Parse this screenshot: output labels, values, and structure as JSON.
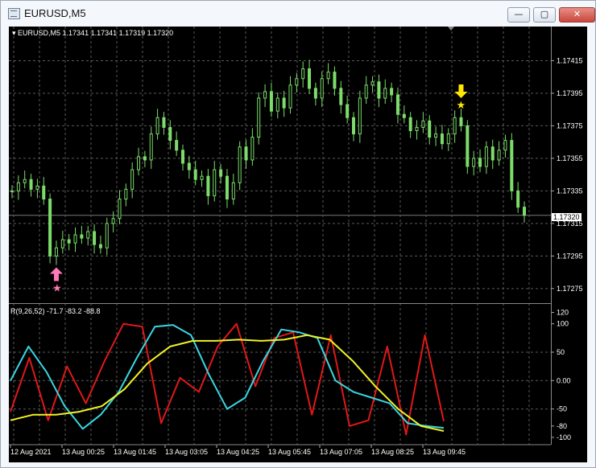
{
  "window": {
    "title": "EURUSD,M5",
    "minimize_label": "—",
    "maximize_label": "▢",
    "close_label": "✕"
  },
  "main_pane": {
    "label": "EURUSD,M5  1.17341 1.17341 1.17319 1.17320",
    "current_price": "1.17320",
    "y_ticks": [
      "1.17415",
      "1.17395",
      "1.17375",
      "1.17355",
      "1.17335",
      "1.17315",
      "1.17295",
      "1.17275"
    ]
  },
  "indicator_pane": {
    "label": "R(9,26,52) -71.7 -83.2 -88.8",
    "y_ticks": [
      "120",
      "100",
      "50",
      "0.00",
      "-50",
      "-80",
      "-100"
    ]
  },
  "time_axis": [
    "12 Aug 2021",
    "13 Aug 00:25",
    "13 Aug 01:45",
    "13 Aug 03:05",
    "13 Aug 04:25",
    "13 Aug 05:45",
    "13 Aug 07:05",
    "13 Aug 08:25",
    "13 Aug 09:45"
  ],
  "colors": {
    "background": "#000000",
    "candles": "#7cdc6a",
    "grid": "#5a5a5a",
    "line_red": "#e01818",
    "line_cyan": "#39d6e3",
    "line_yellow": "#f2f224",
    "buy_arrow": "#ff79b8",
    "sell_arrow": "#ffe600"
  },
  "chart_data": [
    {
      "type": "candlestick",
      "symbol": "EURUSD",
      "timeframe": "M5",
      "ylim": [
        1.17268,
        1.17434
      ],
      "close": [
        1.17335,
        1.1734,
        1.17342,
        1.17336,
        1.17338,
        1.1733,
        1.17295,
        1.173,
        1.17305,
        1.17303,
        1.17308,
        1.17306,
        1.1731,
        1.17302,
        1.173,
        1.17315,
        1.17318,
        1.1733,
        1.17336,
        1.17348,
        1.17356,
        1.17354,
        1.1737,
        1.1738,
        1.17374,
        1.17366,
        1.1736,
        1.17352,
        1.17348,
        1.17342,
        1.17344,
        1.17332,
        1.17348,
        1.17344,
        1.1733,
        1.1734,
        1.17362,
        1.17354,
        1.17368,
        1.17392,
        1.17396,
        1.17384,
        1.17392,
        1.17386,
        1.174,
        1.17404,
        1.1741,
        1.17398,
        1.17392,
        1.17404,
        1.17408,
        1.17398,
        1.17388,
        1.1738,
        1.1737,
        1.17392,
        1.174,
        1.17402,
        1.17392,
        1.17398,
        1.17394,
        1.17382,
        1.1738,
        1.17372,
        1.17374,
        1.17378,
        1.17368,
        1.1737,
        1.17364,
        1.1737,
        1.1738,
        1.17375,
        1.1735,
        1.17355,
        1.1735,
        1.17362,
        1.17354,
        1.1736,
        1.17366,
        1.17335,
        1.17325,
        1.1732
      ],
      "annotations": [
        "buy arrow with star near 13 Aug 00:10",
        "sell arrow with star near 13 Aug 07:15"
      ]
    },
    {
      "type": "line",
      "title": "R(9,26,52) -71.7 -83.2 -88.8",
      "ylim": [
        -110,
        125
      ],
      "x": [
        "12 Aug 2021",
        "13 Aug 00:25",
        "13 Aug 01:45",
        "13 Aug 03:05",
        "13 Aug 04:25",
        "13 Aug 05:45",
        "13 Aug 07:05",
        "13 Aug 08:25",
        "13 Aug 09:45"
      ],
      "series": [
        {
          "name": "",
          "color": "#e01818",
          "values": [
            -55,
            40,
            -70,
            25,
            -40,
            35,
            100,
            95,
            -75,
            5,
            -20,
            60,
            100,
            -10,
            75,
            85,
            -60,
            80,
            -80,
            -70,
            60,
            -95,
            80,
            -71.7
          ]
        },
        {
          "name": "",
          "color": "#39d6e3",
          "values": [
            0,
            60,
            15,
            -45,
            -85,
            -60,
            -20,
            40,
            95,
            98,
            80,
            10,
            -50,
            -30,
            35,
            90,
            85,
            75,
            0,
            -20,
            -30,
            -40,
            -75,
            -80,
            -83.2
          ]
        },
        {
          "name": "",
          "color": "#f2f224",
          "values": [
            -70,
            -60,
            -60,
            -55,
            -45,
            -15,
            30,
            60,
            70,
            70,
            72,
            70,
            72,
            80,
            72,
            35,
            -10,
            -50,
            -80,
            -88.8
          ]
        }
      ]
    }
  ]
}
